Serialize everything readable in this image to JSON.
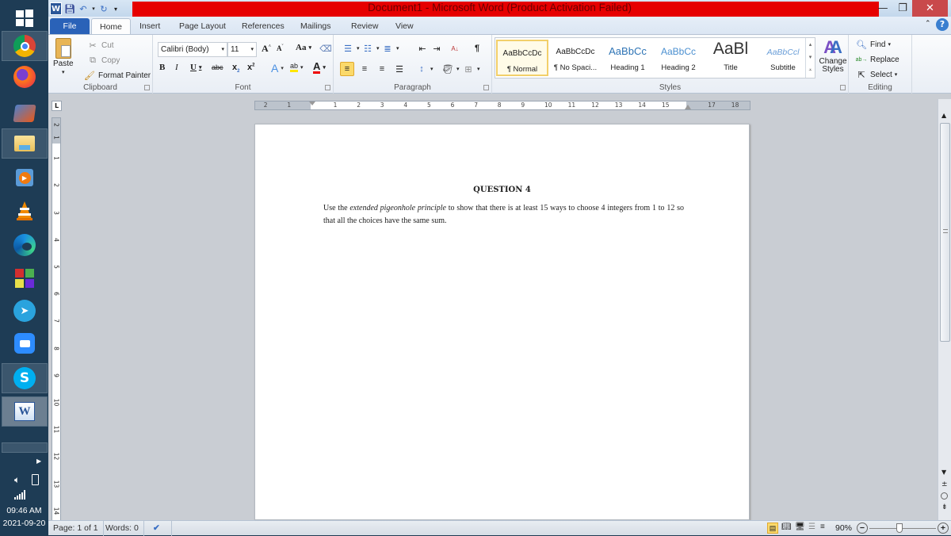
{
  "taskbar": {
    "items": [
      {
        "name": "start",
        "label": "Start"
      },
      {
        "name": "chrome",
        "label": "Google Chrome"
      },
      {
        "name": "firefox",
        "label": "Firefox"
      },
      {
        "name": "movie-maker",
        "label": "Movie Maker"
      },
      {
        "name": "file-explorer",
        "label": "File Explorer"
      },
      {
        "name": "media-player",
        "label": "Media Player"
      },
      {
        "name": "vlc",
        "label": "VLC"
      },
      {
        "name": "edge",
        "label": "Microsoft Edge"
      },
      {
        "name": "app-grid",
        "label": "App"
      },
      {
        "name": "telegram",
        "label": "Telegram"
      },
      {
        "name": "zoom",
        "label": "Zoom"
      },
      {
        "name": "skype",
        "label": "Skype"
      },
      {
        "name": "word",
        "label": "Microsoft Word"
      }
    ],
    "time": "09:46 AM",
    "date": "2021-09-20"
  },
  "window": {
    "title": "Document1  -  Microsoft Word (Product Activation Failed)",
    "title_color": "#e60000"
  },
  "tabs": [
    {
      "label": "File"
    },
    {
      "label": "Home",
      "active": true
    },
    {
      "label": "Insert"
    },
    {
      "label": "Page Layout"
    },
    {
      "label": "References"
    },
    {
      "label": "Mailings"
    },
    {
      "label": "Review"
    },
    {
      "label": "View"
    }
  ],
  "ribbon": {
    "clipboard": {
      "label": "Clipboard",
      "paste": "Paste",
      "cut": "Cut",
      "copy": "Copy",
      "format_painter": "Format Painter"
    },
    "font": {
      "label": "Font",
      "font_name": "Calibri (Body)",
      "font_size": "11",
      "change_case": "Aa"
    },
    "paragraph": {
      "label": "Paragraph"
    },
    "styles": {
      "label": "Styles",
      "items": [
        {
          "sample": "AaBbCcDc",
          "name": "¶ Normal",
          "selected": true
        },
        {
          "sample": "AaBbCcDc",
          "name": "¶ No Spaci..."
        },
        {
          "sample": "AaBbCc",
          "name": "Heading 1"
        },
        {
          "sample": "AaBbCc",
          "name": "Heading 2"
        },
        {
          "sample": "AaBl",
          "name": "Title"
        },
        {
          "sample": "AaBbCcl",
          "name": "Subtitle"
        }
      ],
      "change_styles": "Change Styles"
    },
    "editing": {
      "label": "Editing",
      "find": "Find",
      "replace": "Replace",
      "select": "Select"
    }
  },
  "ruler": {
    "h_left": [
      "2",
      "1"
    ],
    "h_main": [
      "1",
      "2",
      "3",
      "4",
      "5",
      "6",
      "7",
      "8",
      "9",
      "10",
      "11",
      "12",
      "13",
      "14",
      "15"
    ],
    "h_right": [
      "17",
      "18"
    ],
    "v_top": [
      "2",
      "1"
    ],
    "v_main": [
      "1",
      "2",
      "3",
      "4",
      "5",
      "6",
      "7",
      "8",
      "9",
      "10",
      "11",
      "12",
      "13",
      "14"
    ]
  },
  "document": {
    "heading": "QUESTION 4",
    "body_prefix": "Use the ",
    "body_emphasis": "extended pigeonhole principle",
    "body_suffix": " to show that there is at least 15 ways to choose 4 integers from 1 to 12 so that all the choices have the same sum."
  },
  "status": {
    "page": "Page: 1 of 1",
    "words": "Words: 0",
    "zoom": "90%",
    "zoom_fraction": 0.45
  }
}
